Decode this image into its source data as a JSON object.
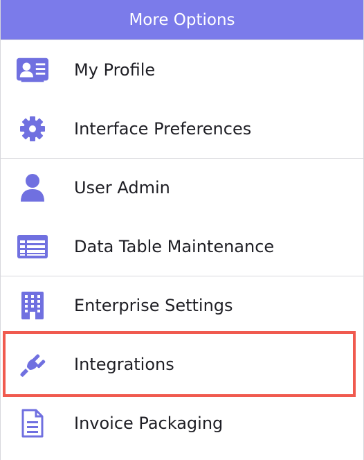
{
  "header": {
    "title": "More Options"
  },
  "items": [
    {
      "label": "My Profile",
      "icon": "profile-card-icon"
    },
    {
      "label": "Interface Preferences",
      "icon": "gear-icon"
    },
    {
      "label": "User Admin",
      "icon": "user-icon"
    },
    {
      "label": "Data Table Maintenance",
      "icon": "table-icon"
    },
    {
      "label": "Enterprise Settings",
      "icon": "building-icon"
    },
    {
      "label": "Integrations",
      "icon": "plug-icon"
    },
    {
      "label": "Invoice Packaging",
      "icon": "document-icon"
    }
  ],
  "highlighted_item": "Integrations",
  "colors": {
    "accent": "#7b7bea",
    "icon": "#7070e0",
    "highlight_border": "#f05a4f"
  }
}
